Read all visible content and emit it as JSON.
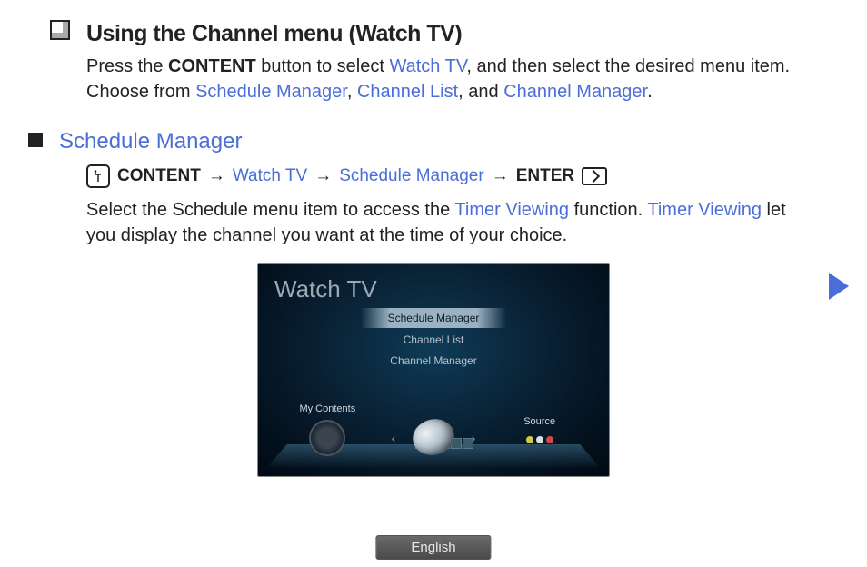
{
  "header": {
    "title": "Using the Channel menu (Watch TV)",
    "intro_pre": "Press the ",
    "intro_bold": "CONTENT",
    "intro_mid": " button to select ",
    "link_watchtv": "Watch TV",
    "intro_post1": ", and then select the desired menu item. Choose from ",
    "link_sched": "Schedule Manager",
    "intro_comma1": ", ",
    "link_chlist": "Channel List",
    "intro_and": ", and ",
    "link_chmgr": "Channel Manager",
    "intro_end": "."
  },
  "section2": {
    "title": "Schedule Manager",
    "path": {
      "p1": "CONTENT",
      "arrow": "→",
      "p2": "Watch TV",
      "p3": "Schedule Manager",
      "p4": "ENTER"
    },
    "para_pre": "Select the Schedule menu item to access the ",
    "link_tv1": "Timer Viewing",
    "para_mid": " function. ",
    "link_tv2": "Timer Viewing",
    "para_post": " let you display the channel you want at the time of your choice."
  },
  "tv": {
    "title": "Watch TV",
    "menu": [
      "Schedule Manager",
      "Channel List",
      "Channel Manager"
    ],
    "dock": {
      "left": "My Contents",
      "right": "Source"
    }
  },
  "footer": {
    "language": "English"
  }
}
